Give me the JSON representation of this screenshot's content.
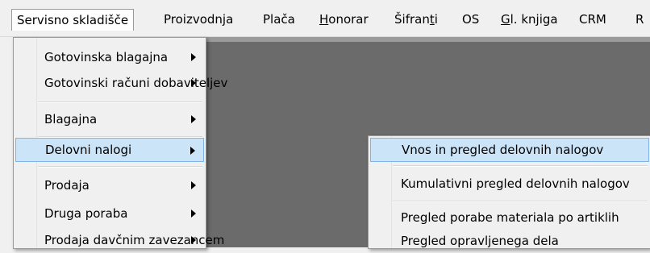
{
  "menubar": {
    "items": [
      {
        "label": "Servisno skladišče",
        "active": true
      },
      {
        "label": "Proizvodnja"
      },
      {
        "label": "Plača"
      },
      {
        "label": "Honorar",
        "underline": "H"
      },
      {
        "label": "Šifranti",
        "underline": "t"
      },
      {
        "label": "OS"
      },
      {
        "label": "Gl. knjiga",
        "underline": "G"
      },
      {
        "label": "CRM"
      },
      {
        "label": "R"
      }
    ]
  },
  "menu": {
    "items": [
      {
        "label": "Gotovinska blagajna",
        "submenu": true
      },
      {
        "label": "Gotovinski računi dobaviteljev",
        "submenu": true
      },
      {
        "label": "Blagajna",
        "submenu": true
      },
      {
        "label": "Delovni nalogi",
        "submenu": true,
        "highlighted": true
      },
      {
        "label": "Prodaja",
        "submenu": true
      },
      {
        "label": "Druga poraba",
        "submenu": true
      },
      {
        "label": "Prodaja davčnim zavezancem",
        "submenu": true
      }
    ]
  },
  "submenu": {
    "items": [
      {
        "label": "Vnos in pregled delovnih nalogov",
        "highlighted": true
      },
      {
        "label": "Kumulativni pregled delovnih nalogov"
      },
      {
        "label": "Pregled porabe materiala po artiklih"
      },
      {
        "label": "Pregled opravljenega dela"
      }
    ]
  },
  "colors": {
    "highlight": "#cce4f7",
    "highlight_border": "#7eb4ea",
    "workarea": "#6b6b6b"
  }
}
